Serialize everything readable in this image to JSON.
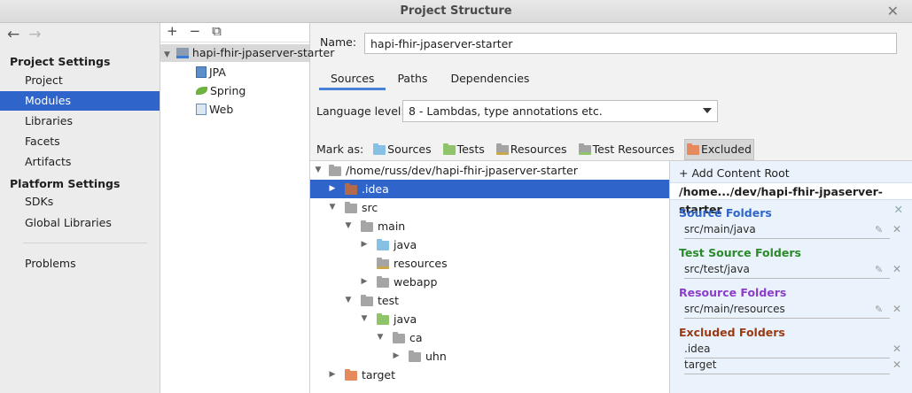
{
  "window": {
    "title": "Project Structure"
  },
  "colors": {
    "selection": "#2f65ca",
    "source": "#2f65ca",
    "test": "#2a8a2a",
    "resource": "#8a3ec9",
    "excluded": "#9a3a12"
  },
  "left_nav": {
    "project_settings_header": "Project Settings",
    "project_items": [
      "Project",
      "Modules",
      "Libraries",
      "Facets",
      "Artifacts"
    ],
    "selected": "Modules",
    "platform_settings_header": "Platform Settings",
    "platform_items": [
      "SDKs",
      "Global Libraries"
    ],
    "problems": "Problems"
  },
  "modules": {
    "toolbar": [
      "+",
      "−",
      "⧉"
    ],
    "root": "hapi-fhir-jpaserver-starter",
    "facets": [
      "JPA",
      "Spring",
      "Web"
    ]
  },
  "module": {
    "name_label": "Name:",
    "name_value": "hapi-fhir-jpaserver-starter",
    "tabs": [
      "Sources",
      "Paths",
      "Dependencies"
    ],
    "active_tab": "Sources",
    "language_label": "Language level:",
    "language_value": "8 - Lambdas, type annotations etc."
  },
  "mark_as": {
    "label": "Mark as:",
    "buttons": [
      "Sources",
      "Tests",
      "Resources",
      "Test Resources",
      "Excluded"
    ],
    "pressed": "Excluded"
  },
  "tree": [
    {
      "label": "/home/russ/dev/hapi-fhir-jpaserver-starter",
      "toggle": "down"
    },
    {
      "label": ".idea",
      "toggle": "right",
      "selected": true
    },
    {
      "label": "src",
      "toggle": "down"
    },
    {
      "label": "main",
      "toggle": "down"
    },
    {
      "label": "java",
      "toggle": "right"
    },
    {
      "label": "resources",
      "toggle": ""
    },
    {
      "label": "webapp",
      "toggle": "right"
    },
    {
      "label": "test",
      "toggle": "down"
    },
    {
      "label": "java",
      "toggle": "down"
    },
    {
      "label": "ca",
      "toggle": "down"
    },
    {
      "label": "uhn",
      "toggle": "right"
    },
    {
      "label": "target",
      "toggle": "right"
    }
  ],
  "content_roots": {
    "add_label": "Add Content Root",
    "root_path": "/home.../dev/hapi-fhir-jpaserver-starter",
    "source_title": "Source Folders",
    "source_entries": [
      "src/main/java"
    ],
    "test_title": "Test Source Folders",
    "test_entries": [
      "src/test/java"
    ],
    "resource_title": "Resource Folders",
    "resource_entries": [
      "src/main/resources"
    ],
    "excluded_title": "Excluded Folders",
    "excluded_entries": [
      ".idea",
      "target"
    ]
  }
}
